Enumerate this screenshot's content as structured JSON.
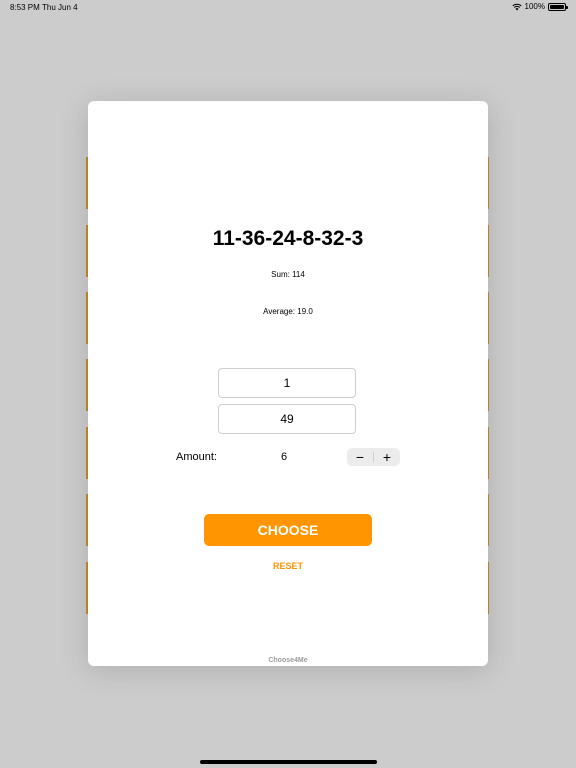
{
  "status_bar": {
    "time": "8:53 PM",
    "date": "Thu Jun 4",
    "battery": "100%"
  },
  "result": "11-36-24-8-32-3",
  "sum_text": "Sum: 114",
  "average_text": "Average: 19.0",
  "range": {
    "min_value": "1",
    "max_value": "49"
  },
  "amount": {
    "label": "Amount:",
    "value": "6",
    "decrement": "−",
    "increment": "+"
  },
  "choose_label": "CHOOSE",
  "reset_label": "RESET",
  "footer": "Choose4Me",
  "colors": {
    "accent": "#ff9500",
    "background": "#cccccc",
    "stripe": "#c68a2e"
  },
  "icons": [
    "wifi-icon",
    "battery-icon"
  ]
}
